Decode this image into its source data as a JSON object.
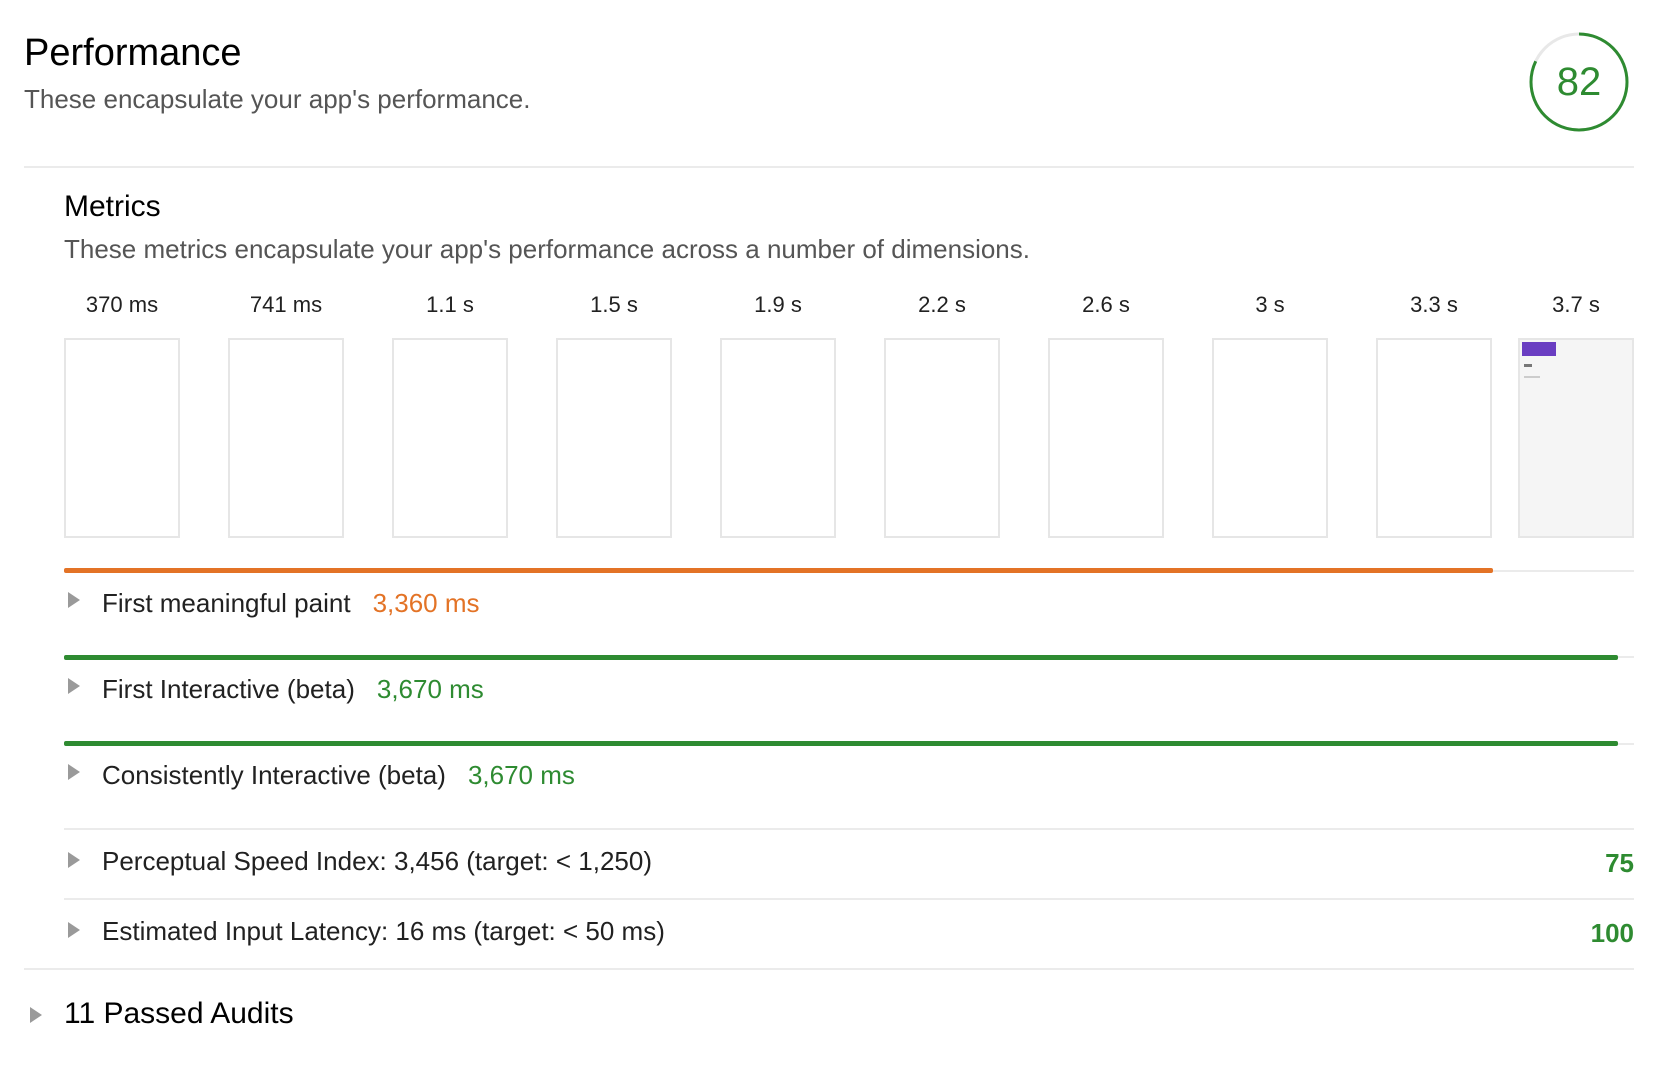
{
  "header": {
    "title": "Performance",
    "description": "These encapsulate your app's performance.",
    "score": "82",
    "score_fraction": 0.82,
    "score_color": "#2e8b31"
  },
  "metrics": {
    "title": "Metrics",
    "description": "These metrics encapsulate your app's performance across a number of dimensions.",
    "filmstrip": [
      {
        "label": "370 ms",
        "painted": false
      },
      {
        "label": "741 ms",
        "painted": false
      },
      {
        "label": "1.1 s",
        "painted": false
      },
      {
        "label": "1.5 s",
        "painted": false
      },
      {
        "label": "1.9 s",
        "painted": false
      },
      {
        "label": "2.2 s",
        "painted": false
      },
      {
        "label": "2.6 s",
        "painted": false
      },
      {
        "label": "3 s",
        "painted": false
      },
      {
        "label": "3.3 s",
        "painted": false
      },
      {
        "label": "3.7 s",
        "painted": true
      }
    ],
    "timed": [
      {
        "label": "First meaningful paint",
        "value": "3,360 ms",
        "color": "#e37326",
        "fraction": 0.91
      },
      {
        "label": "First Interactive (beta)",
        "value": "3,670 ms",
        "color": "#2e8b31",
        "fraction": 0.99
      },
      {
        "label": "Consistently Interactive (beta)",
        "value": "3,670 ms",
        "color": "#2e8b31",
        "fraction": 0.99
      }
    ],
    "scored": [
      {
        "label": "Perceptual Speed Index: 3,456 (target: < 1,250)",
        "score": "75"
      },
      {
        "label": "Estimated Input Latency: 16 ms (target: < 50 ms)",
        "score": "100"
      }
    ]
  },
  "passed_audits": {
    "label": "11 Passed Audits"
  },
  "icons": {
    "expand": "chevron-right-icon"
  }
}
